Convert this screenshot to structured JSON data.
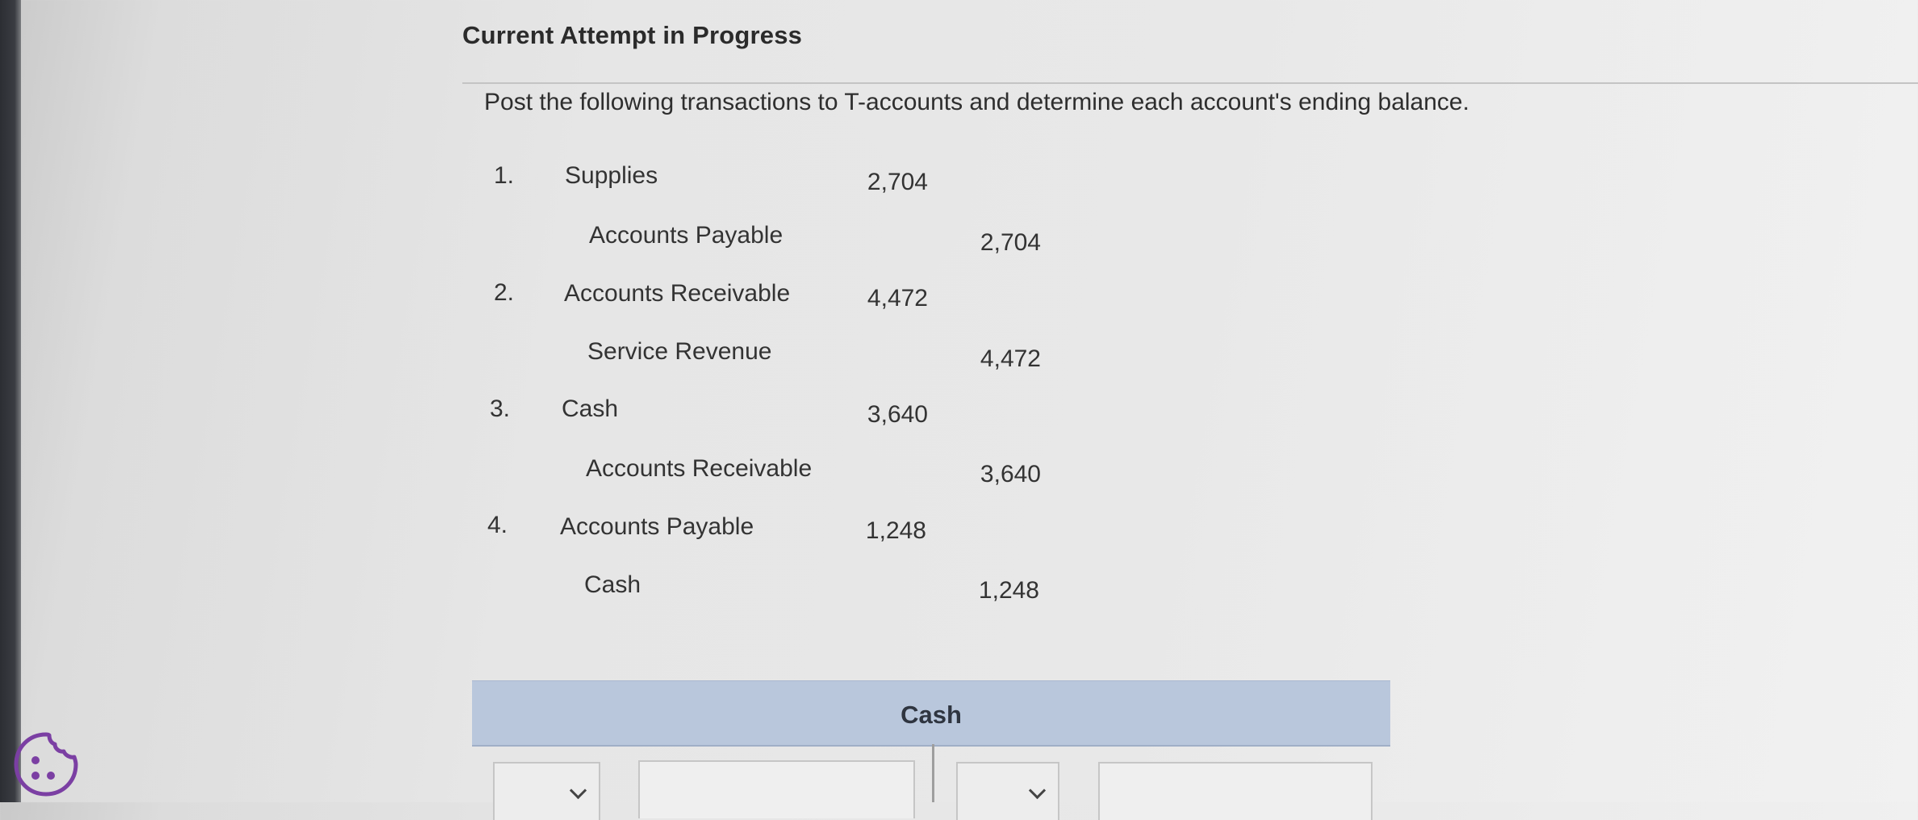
{
  "page": {
    "heading": "Current Attempt in Progress",
    "instructions": "Post the following transactions to T-accounts and determine each account's ending balance."
  },
  "transactions": [
    {
      "number": "1.",
      "debit_account": "Supplies",
      "debit_amount": "2,704",
      "credit_account": "Accounts Payable",
      "credit_amount": "2,704"
    },
    {
      "number": "2.",
      "debit_account": "Accounts Receivable",
      "debit_amount": "4,472",
      "credit_account": "Service Revenue",
      "credit_amount": "4,472"
    },
    {
      "number": "3.",
      "debit_account": "Cash",
      "debit_amount": "3,640",
      "credit_account": "Accounts Receivable",
      "credit_amount": "3,640"
    },
    {
      "number": "4.",
      "debit_account": "Accounts Payable",
      "debit_amount": "1,248",
      "credit_account": "Cash",
      "credit_amount": "1,248"
    }
  ],
  "t_account": {
    "title": "Cash",
    "left_select_value": "",
    "left_amount_value": "",
    "right_select_value": "",
    "right_amount_value": ""
  },
  "icons": {
    "cookie": "cookie-icon",
    "chevron": "chevron-down-icon"
  },
  "colors": {
    "t_account_header": "#b9c7dc",
    "cookie_accent": "#7b3fa3"
  }
}
